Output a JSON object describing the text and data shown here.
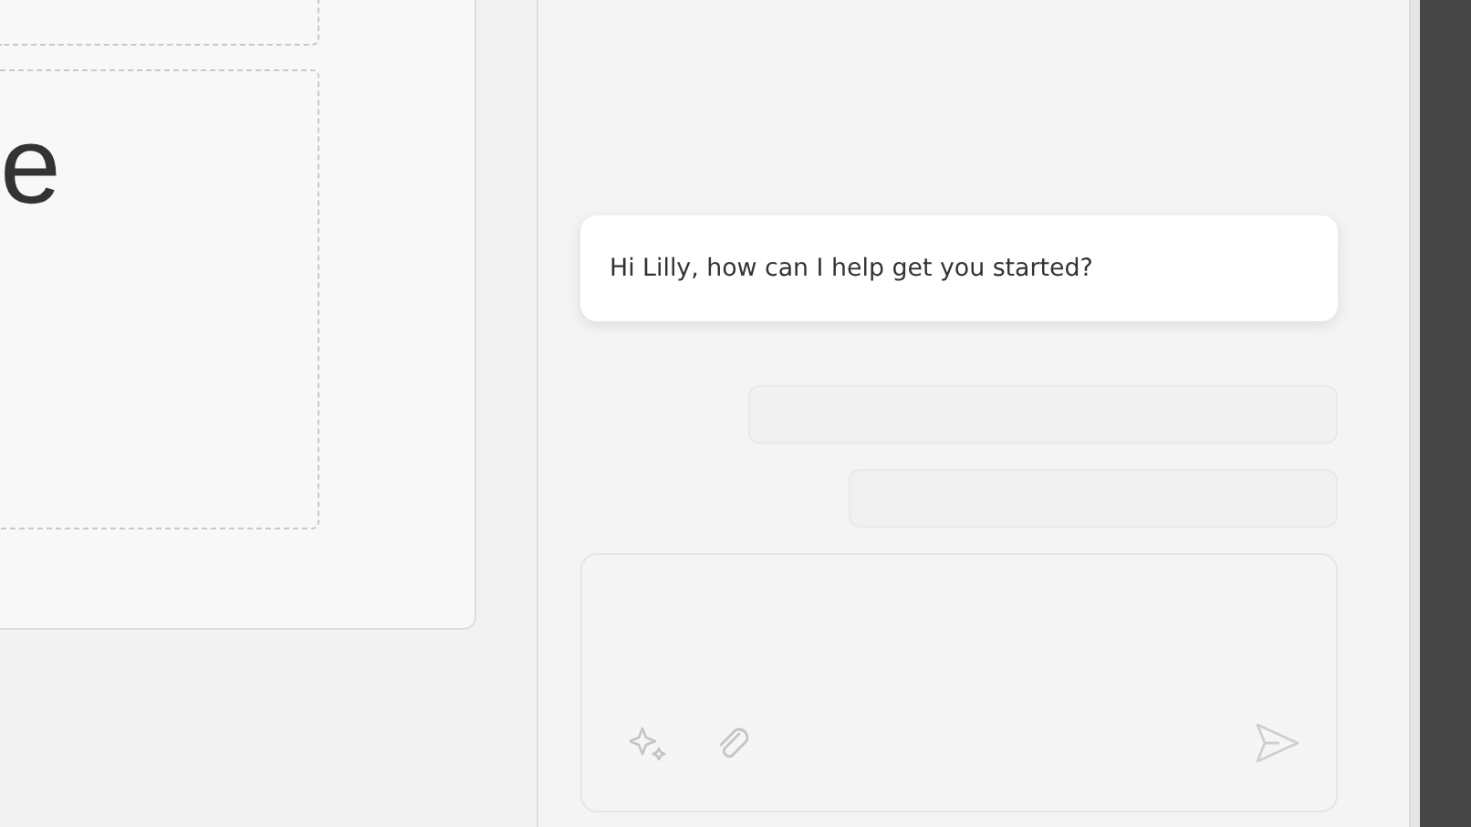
{
  "canvas": {
    "heading_fragment": "e"
  },
  "chat": {
    "messages": [
      {
        "kind": "assistant",
        "text": "Hi Lilly, how can I help get you started?"
      }
    ],
    "loading_placeholders": [
      {
        "kind": "skeleton"
      },
      {
        "kind": "skeleton"
      }
    ],
    "composer": {
      "tools": [
        {
          "kind": "sparkle"
        },
        {
          "kind": "attach"
        }
      ],
      "send_disabled": true
    }
  }
}
